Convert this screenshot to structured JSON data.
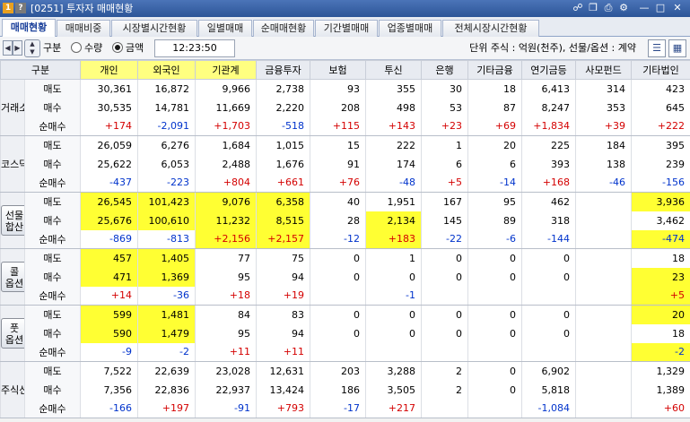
{
  "window": {
    "badge1": "1",
    "badge2": "?",
    "title": "[0251] 투자자 매매현황"
  },
  "tabs": [
    "매매현황",
    "매매비중",
    "시장별시간현황",
    "일별매매",
    "순매매현황",
    "기간별매매",
    "업종별매매",
    "전체시장시간현황"
  ],
  "controls": {
    "gubun_label": "구분",
    "radio_qty": "수량",
    "radio_amount": "금액",
    "selected": "금액",
    "time": "12:23:50",
    "unit_text": "단위 주식 : 억원(천주), 선물/옵션 : 계약"
  },
  "columns": [
    "구분",
    "개인",
    "외국인",
    "기관계",
    "금융투자",
    "보험",
    "투신",
    "은행",
    "기타금융",
    "연기금등",
    "사모펀드",
    "기타법인"
  ],
  "highlight_columns": [
    1,
    2,
    3
  ],
  "row_labels": [
    "매도",
    "매수",
    "순매수"
  ],
  "groups": [
    {
      "name": "거래소",
      "button": false,
      "rows": [
        [
          "30,361",
          "16,872",
          "9,966",
          "2,738",
          "93",
          "355",
          "30",
          "18",
          "6,413",
          "314",
          "423"
        ],
        [
          "30,535",
          "14,781",
          "11,669",
          "2,220",
          "208",
          "498",
          "53",
          "87",
          "8,247",
          "353",
          "645"
        ],
        [
          "+174",
          "-2,091",
          "+1,703",
          "-518",
          "+115",
          "+143",
          "+23",
          "+69",
          "+1,834",
          "+39",
          "+222"
        ]
      ],
      "yellow": [
        [],
        [],
        []
      ]
    },
    {
      "name": "코스닥",
      "button": false,
      "rows": [
        [
          "26,059",
          "6,276",
          "1,684",
          "1,015",
          "15",
          "222",
          "1",
          "20",
          "225",
          "184",
          "395"
        ],
        [
          "25,622",
          "6,053",
          "2,488",
          "1,676",
          "91",
          "174",
          "6",
          "6",
          "393",
          "138",
          "239"
        ],
        [
          "-437",
          "-223",
          "+804",
          "+661",
          "+76",
          "-48",
          "+5",
          "-14",
          "+168",
          "-46",
          "-156"
        ]
      ],
      "yellow": [
        [],
        [],
        []
      ]
    },
    {
      "name": "선물합산",
      "button": true,
      "btn_line1": "선물",
      "btn_line2": "합산",
      "rows": [
        [
          "26,545",
          "101,423",
          "9,076",
          "6,358",
          "40",
          "1,951",
          "167",
          "95",
          "462",
          "",
          "3,936"
        ],
        [
          "25,676",
          "100,610",
          "11,232",
          "8,515",
          "28",
          "2,134",
          "145",
          "89",
          "318",
          "",
          "3,462"
        ],
        [
          "-869",
          "-813",
          "+2,156",
          "+2,157",
          "-12",
          "+183",
          "-22",
          "-6",
          "-144",
          "",
          "-474"
        ]
      ],
      "yellow": [
        [
          0,
          1,
          2,
          3,
          10
        ],
        [
          0,
          1,
          2,
          3,
          5
        ],
        [
          2,
          3,
          5,
          10
        ]
      ]
    },
    {
      "name": "콜옵션",
      "button": true,
      "btn_line1": "콜",
      "btn_line2": "옵션",
      "rows": [
        [
          "457",
          "1,405",
          "77",
          "75",
          "0",
          "1",
          "0",
          "0",
          "0",
          "",
          "18"
        ],
        [
          "471",
          "1,369",
          "95",
          "94",
          "0",
          "0",
          "0",
          "0",
          "0",
          "",
          "23"
        ],
        [
          "+14",
          "-36",
          "+18",
          "+19",
          "",
          "-1",
          "",
          "",
          "",
          "",
          "+5"
        ]
      ],
      "yellow": [
        [
          0,
          1
        ],
        [
          0,
          1,
          10
        ],
        [
          10
        ]
      ]
    },
    {
      "name": "풋옵션",
      "button": true,
      "btn_line1": "풋",
      "btn_line2": "옵션",
      "rows": [
        [
          "599",
          "1,481",
          "84",
          "83",
          "0",
          "0",
          "0",
          "0",
          "0",
          "",
          "20"
        ],
        [
          "590",
          "1,479",
          "95",
          "94",
          "0",
          "0",
          "0",
          "0",
          "0",
          "",
          "18"
        ],
        [
          "-9",
          "-2",
          "+11",
          "+11",
          "",
          "",
          "",
          "",
          "",
          "",
          "-2"
        ]
      ],
      "yellow": [
        [
          0,
          1,
          10
        ],
        [
          0,
          1
        ],
        [
          10
        ]
      ]
    },
    {
      "name": "주식선",
      "button": false,
      "rows": [
        [
          "7,522",
          "22,639",
          "23,028",
          "12,631",
          "203",
          "3,288",
          "2",
          "0",
          "6,902",
          "",
          "1,329"
        ],
        [
          "7,356",
          "22,836",
          "22,937",
          "13,424",
          "186",
          "3,505",
          "2",
          "0",
          "5,818",
          "",
          "1,389"
        ],
        [
          "-166",
          "+197",
          "-91",
          "+793",
          "-17",
          "+217",
          "",
          "",
          "-1,084",
          "",
          "+60"
        ]
      ],
      "yellow": [
        [],
        [],
        []
      ]
    }
  ],
  "colors": {
    "positive": "#d40000",
    "negative": "#0033cc",
    "highlight": "#ffff33"
  },
  "icons": [
    "app-menu-icon",
    "help-icon",
    "link-icon",
    "copy-icon",
    "print-icon",
    "settings-icon",
    "minimize-icon",
    "maximize-icon",
    "close-icon",
    "refresh-icon",
    "list-view-icon",
    "excel-icon"
  ]
}
